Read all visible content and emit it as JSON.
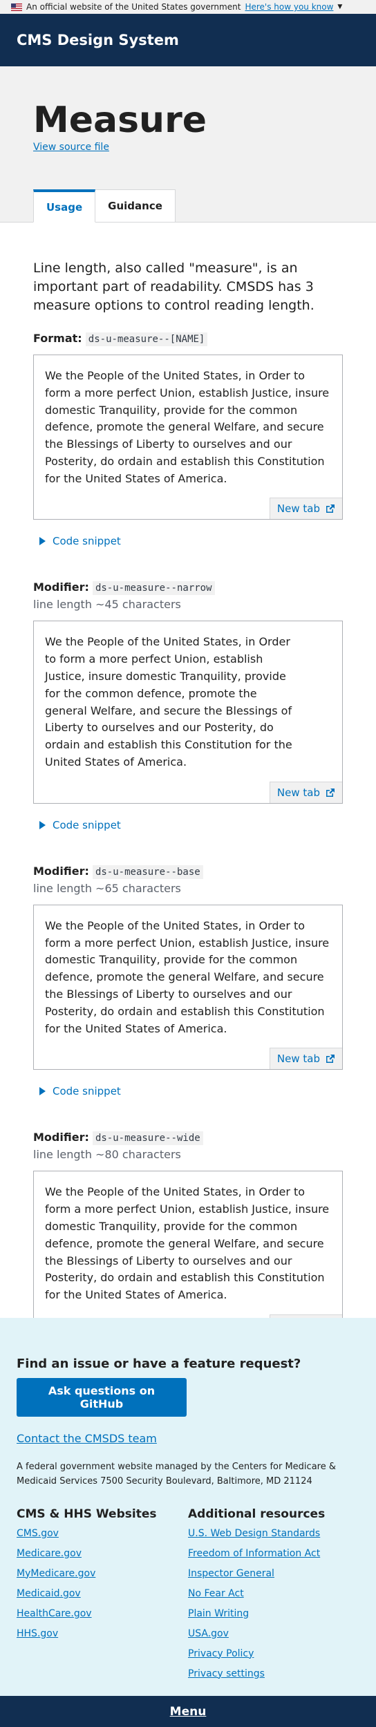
{
  "gov_banner": {
    "text": "An official website of the United States government",
    "link": "Here's how you know"
  },
  "header": {
    "title": "CMS Design System"
  },
  "page": {
    "title": "Measure",
    "source_link": "View source file"
  },
  "tabs": [
    {
      "label": "Usage",
      "active": true
    },
    {
      "label": "Guidance",
      "active": false
    }
  ],
  "intro": "Line length, also called \"measure\", is an important part of readability. CMSDS has 3 measure options to control reading length.",
  "format": {
    "label": "Format:",
    "code": "ds-u-measure--[NAME]"
  },
  "example_text": "We the People of the United States, in Order to form a more perfect Union, establish Justice, insure domestic Tranquility, provide for the common defence, promote the general Welfare, and secure the Blessings of Liberty to ourselves and our Posterity, do ordain and establish this Constitution for the United States of America.",
  "new_tab_label": "New tab",
  "code_snippet_label": "Code snippet",
  "modifiers": [
    {
      "label": "Modifier:",
      "code": "ds-u-measure--narrow",
      "note": "line length ~45 characters"
    },
    {
      "label": "Modifier:",
      "code": "ds-u-measure--base",
      "note": "line length ~65 characters"
    },
    {
      "label": "Modifier:",
      "code": "ds-u-measure--wide",
      "note": "line length ~80 characters"
    }
  ],
  "footer": {
    "heading": "Find an issue or have a feature request?",
    "github_button": "Ask questions on GitHub",
    "contact_link": "Contact the CMSDS team",
    "federal_text": "A federal government website managed by the Centers for Medicare & Medicaid Services 7500 Security Boulevard, Baltimore, MD 21124",
    "cms_hhs": {
      "title": "CMS & HHS Websites",
      "links": [
        "CMS.gov",
        "Medicare.gov",
        "MyMedicare.gov",
        "Medicaid.gov",
        "HealthCare.gov",
        "HHS.gov"
      ]
    },
    "resources": {
      "title": "Additional resources",
      "links": [
        "U.S. Web Design Standards",
        "Freedom of Information Act",
        "Inspector General",
        "No Fear Act",
        "Plain Writing",
        "USA.gov",
        "Privacy Policy",
        "Privacy settings"
      ]
    }
  },
  "menu": {
    "label": "Menu"
  },
  "colors": {
    "header": "#112e51",
    "link": "#0071bc",
    "footer_bg": "#e1f3f8"
  }
}
